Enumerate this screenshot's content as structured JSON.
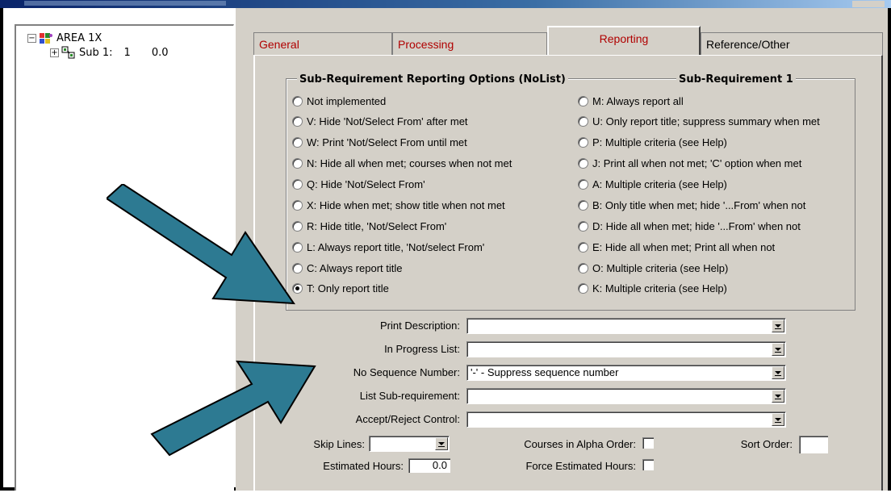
{
  "tree": {
    "root_label": "AREA 1X",
    "child_label": "Sub 1:",
    "child_number": "1",
    "child_value": "0.0"
  },
  "tabs": [
    {
      "label": "General"
    },
    {
      "label": "Processing"
    },
    {
      "label": "Reporting"
    },
    {
      "label": "Reference/Other"
    }
  ],
  "group": {
    "title": "Sub-Requirement Reporting Options (NoList)",
    "subtitle": "Sub-Requirement 1"
  },
  "options_left": [
    "Not implemented",
    "V: Hide 'Not/Select From' after met",
    "W: Print 'Not/Select From until met",
    "N: Hide all when met; courses when not met",
    "Q: Hide 'Not/Select From'",
    "X: Hide when met; show title when not met",
    "R: Hide title, 'Not/Select From'",
    "L: Always report title, 'Not/select From'",
    "C: Always report title",
    "T: Only report title"
  ],
  "options_right": [
    "M: Always report all",
    "U: Only report title; suppress summary when met",
    "P: Multiple criteria (see Help)",
    "J: Print all when not met; 'C' option when met",
    "A: Multiple criteria (see Help)",
    "B: Only title when met; hide '...From' when not",
    "D: Hide all when met; hide '...From' when not",
    "E: Hide all when met; Print all when not",
    "O: Multiple criteria (see Help)",
    "K: Multiple criteria (see Help)"
  ],
  "selected_option": "T: Only report title",
  "fields": {
    "print_description": {
      "label": "Print Description:",
      "value": ""
    },
    "in_progress_list": {
      "label": "In Progress List:",
      "value": ""
    },
    "no_sequence_number": {
      "label": "No Sequence Number:",
      "value": "'-' - Suppress sequence number"
    },
    "list_sub_requirement": {
      "label": "List Sub-requirement:",
      "value": ""
    },
    "accept_reject_control": {
      "label": "Accept/Reject Control:",
      "value": ""
    }
  },
  "bottom": {
    "skip_lines_label": "Skip Lines:",
    "skip_lines_value": "",
    "courses_alpha_label": "Courses in Alpha Order:",
    "sort_order_label": "Sort Order:",
    "sort_order_value": "",
    "estimated_hours_label": "Estimated Hours:",
    "estimated_hours_value": "0.0",
    "force_estimated_label": "Force Estimated Hours:"
  },
  "colors": {
    "panel": "#d4d0c8",
    "tab_text": "#b00000",
    "arrow_fill": "#2d7a92",
    "arrow_stroke": "#000000"
  }
}
